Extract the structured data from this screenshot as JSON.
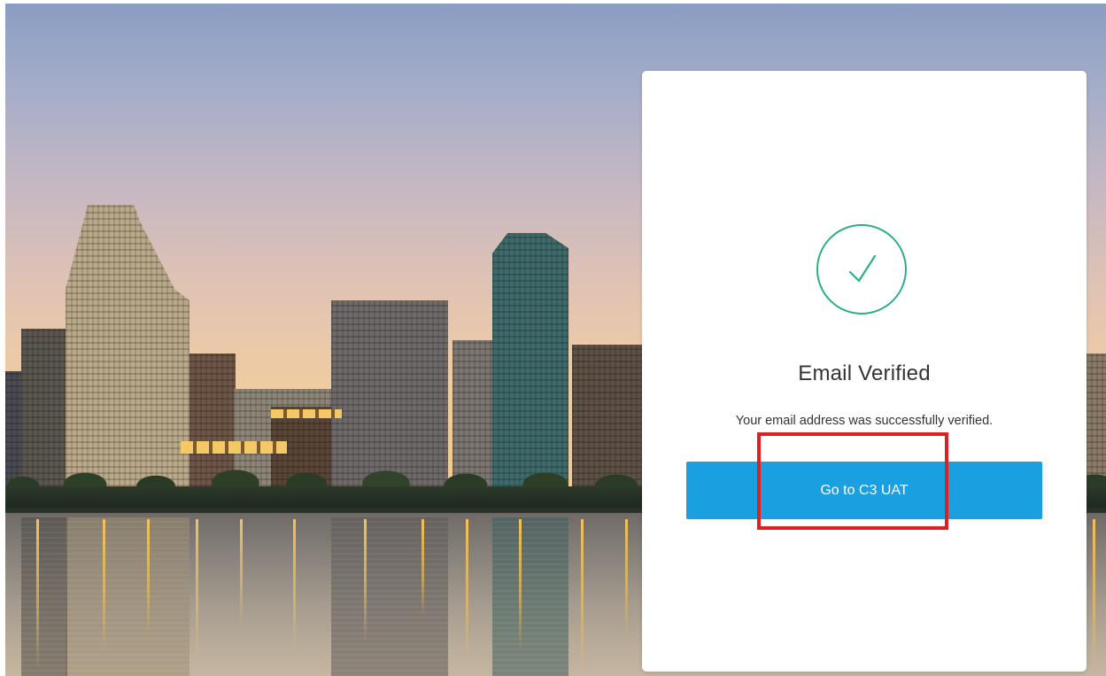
{
  "card": {
    "icon": "checkmark-circle-icon",
    "title": "Email Verified",
    "message": "Your email address was successfully verified.",
    "button_label": "Go to C3 UAT"
  },
  "colors": {
    "accent_button": "#1a9fe0",
    "check_green": "#2cae8a",
    "highlight_red": "#e02020",
    "text": "#333333"
  },
  "background": {
    "description_icon": "city-skyline-background"
  }
}
